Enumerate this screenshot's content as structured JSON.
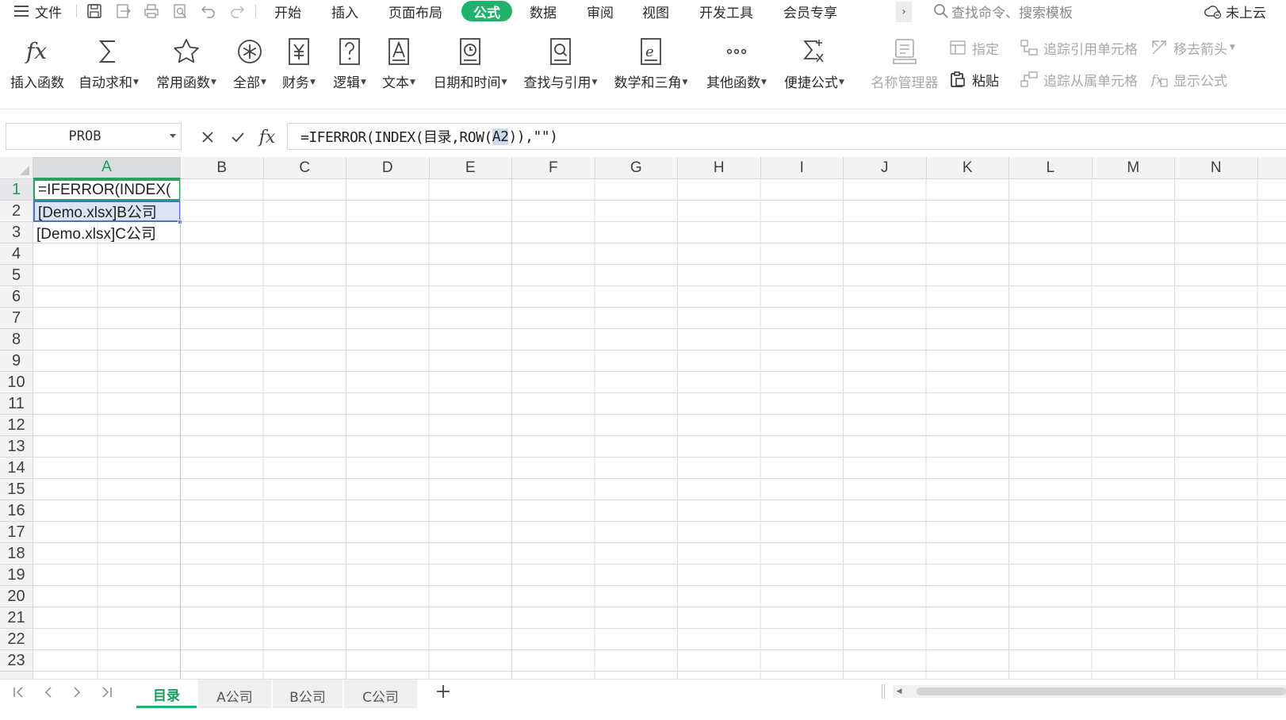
{
  "menubar": {
    "file_label": "文件",
    "tabs": [
      "开始",
      "插入",
      "页面布局",
      "公式",
      "数据",
      "审阅",
      "视图",
      "开发工具",
      "会员专享"
    ],
    "active_tab": "公式",
    "search_placeholder": "查找命令、搜索模板",
    "cloud_status": "未上云"
  },
  "ribbon": {
    "large_buttons": [
      {
        "label": "插入函数",
        "icon": "fx-icon",
        "dropdown": false
      },
      {
        "label": "自动求和",
        "icon": "sigma-icon",
        "dropdown": true
      },
      {
        "label": "常用函数",
        "icon": "star-icon",
        "dropdown": true
      },
      {
        "label": "全部",
        "icon": "asterisk-icon",
        "dropdown": true
      },
      {
        "label": "财务",
        "icon": "yen-icon",
        "dropdown": true
      },
      {
        "label": "逻辑",
        "icon": "question-icon",
        "dropdown": true
      },
      {
        "label": "文本",
        "icon": "text-a-icon",
        "dropdown": true
      },
      {
        "label": "日期和时间",
        "icon": "clock-icon",
        "dropdown": true
      },
      {
        "label": "查找与引用",
        "icon": "magnifier-doc-icon",
        "dropdown": true
      },
      {
        "label": "数学和三角",
        "icon": "theta-icon",
        "dropdown": true
      },
      {
        "label": "其他函数",
        "icon": "ellipsis-icon",
        "dropdown": true
      },
      {
        "label": "便捷公式",
        "icon": "sigma-x-icon",
        "dropdown": true
      },
      {
        "label": "名称管理器",
        "icon": "name-manager-icon",
        "dropdown": false
      }
    ],
    "small_buttons": {
      "assign": "指定",
      "paste": "粘贴",
      "trace_precedents": "追踪引用单元格",
      "trace_dependents": "追踪从属单元格",
      "remove_arrows": "移去箭头",
      "show_formulas": "显示公式"
    }
  },
  "formula_bar": {
    "name_box": "PROB",
    "formula_before": "=IFERROR(INDEX(目录,ROW(",
    "formula_ref": "A2",
    "formula_after": ")),\"\")"
  },
  "grid": {
    "columns": [
      "A",
      "B",
      "C",
      "D",
      "E",
      "F",
      "G",
      "H",
      "I",
      "J",
      "K",
      "L",
      "M",
      "N"
    ],
    "rows": [
      "1",
      "2",
      "3",
      "4",
      "5",
      "6",
      "7",
      "8",
      "9",
      "10",
      "11",
      "12",
      "13",
      "14",
      "15",
      "16",
      "17",
      "18",
      "19",
      "20",
      "21",
      "22",
      "23"
    ],
    "cells": {
      "A1": "=IFERROR(INDEX(",
      "A2": "[Demo.xlsx]B公司",
      "A3": "[Demo.xlsx]C公司"
    }
  },
  "sheet_tabs": [
    "目录",
    "A公司",
    "B公司",
    "C公司"
  ],
  "active_sheet": "目录",
  "colors": {
    "accent": "#1fb26b",
    "active_cell_border": "#2f9e5f",
    "reference_highlight": "#4f72c6"
  }
}
